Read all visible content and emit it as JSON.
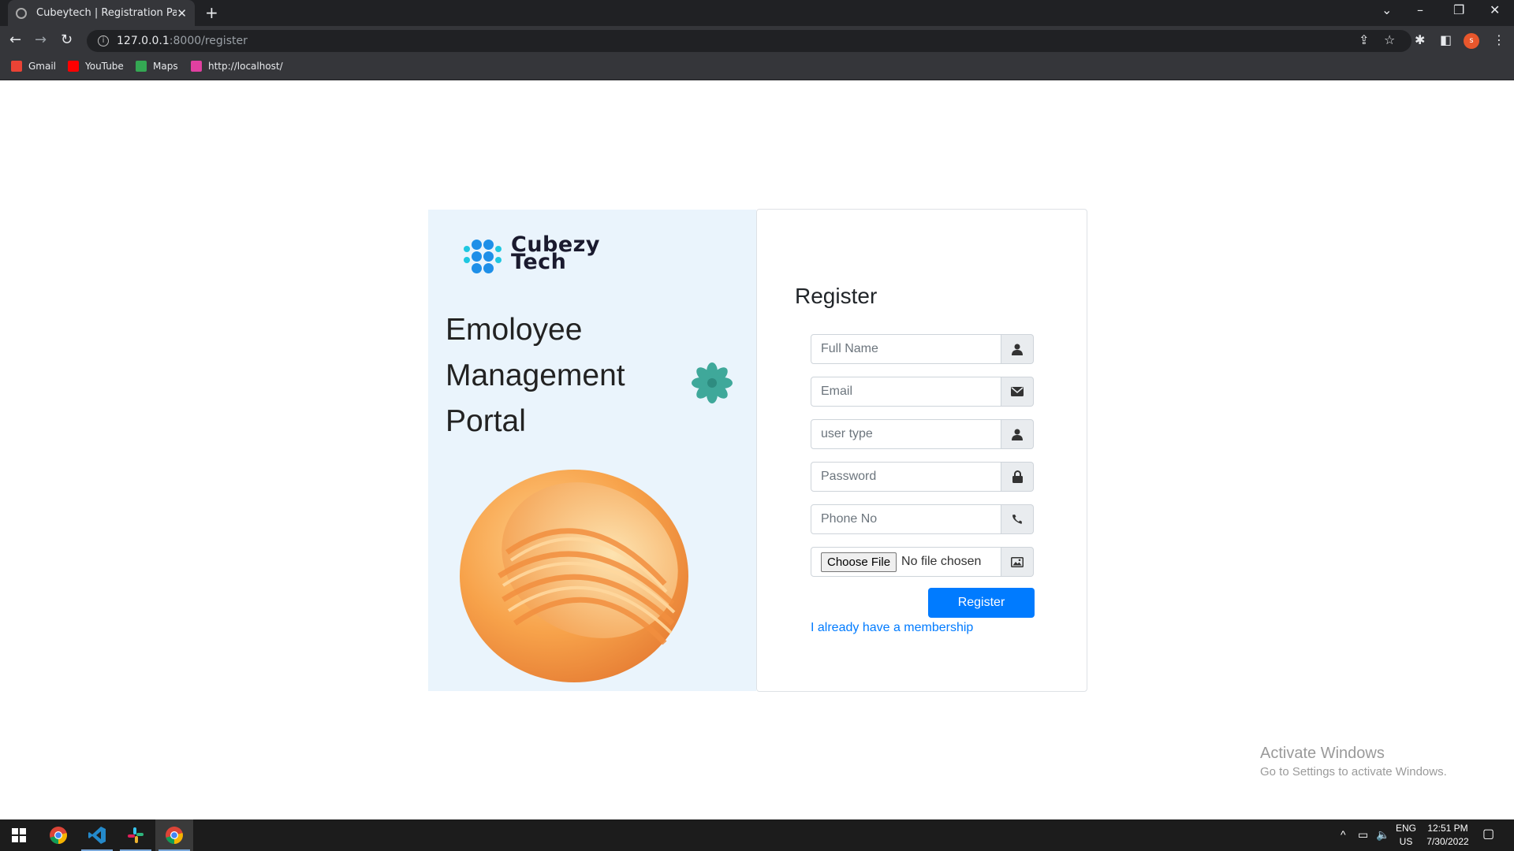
{
  "browser": {
    "tab_title": "Cubeytech | Registration Page",
    "url_host": "127.0.0.1",
    "url_path": ":8000/register",
    "profile_initial": "s",
    "bookmarks": [
      {
        "label": "Gmail",
        "color": "#ea4335"
      },
      {
        "label": "YouTube",
        "color": "#ff0000"
      },
      {
        "label": "Maps",
        "color": "#34a853"
      },
      {
        "label": "http://localhost/",
        "color": "#e040a0"
      }
    ]
  },
  "brand": {
    "name_line1": "Cubezy",
    "name_line2": "Tech"
  },
  "hero": {
    "line1": "Emoloyee",
    "line2": "Management",
    "line3": "Portal"
  },
  "form": {
    "title": "Register",
    "fields": [
      {
        "placeholder": "Full Name",
        "icon": "user-icon"
      },
      {
        "placeholder": "Email",
        "icon": "envelope-icon"
      },
      {
        "placeholder": "user type",
        "icon": "user-icon"
      },
      {
        "placeholder": "Password",
        "icon": "lock-icon"
      },
      {
        "placeholder": "Phone No",
        "icon": "phone-icon"
      }
    ],
    "file_button": "Choose File",
    "file_status": "No file chosen",
    "submit": "Register",
    "login_link": "I already have a membership",
    "accent_color": "#007bff"
  },
  "watermark": {
    "line1": "Activate Windows",
    "line2": "Go to Settings to activate Windows."
  },
  "taskbar": {
    "lang1": "ENG",
    "lang2": "US",
    "time": "12:51 PM",
    "date": "7/30/2022"
  }
}
